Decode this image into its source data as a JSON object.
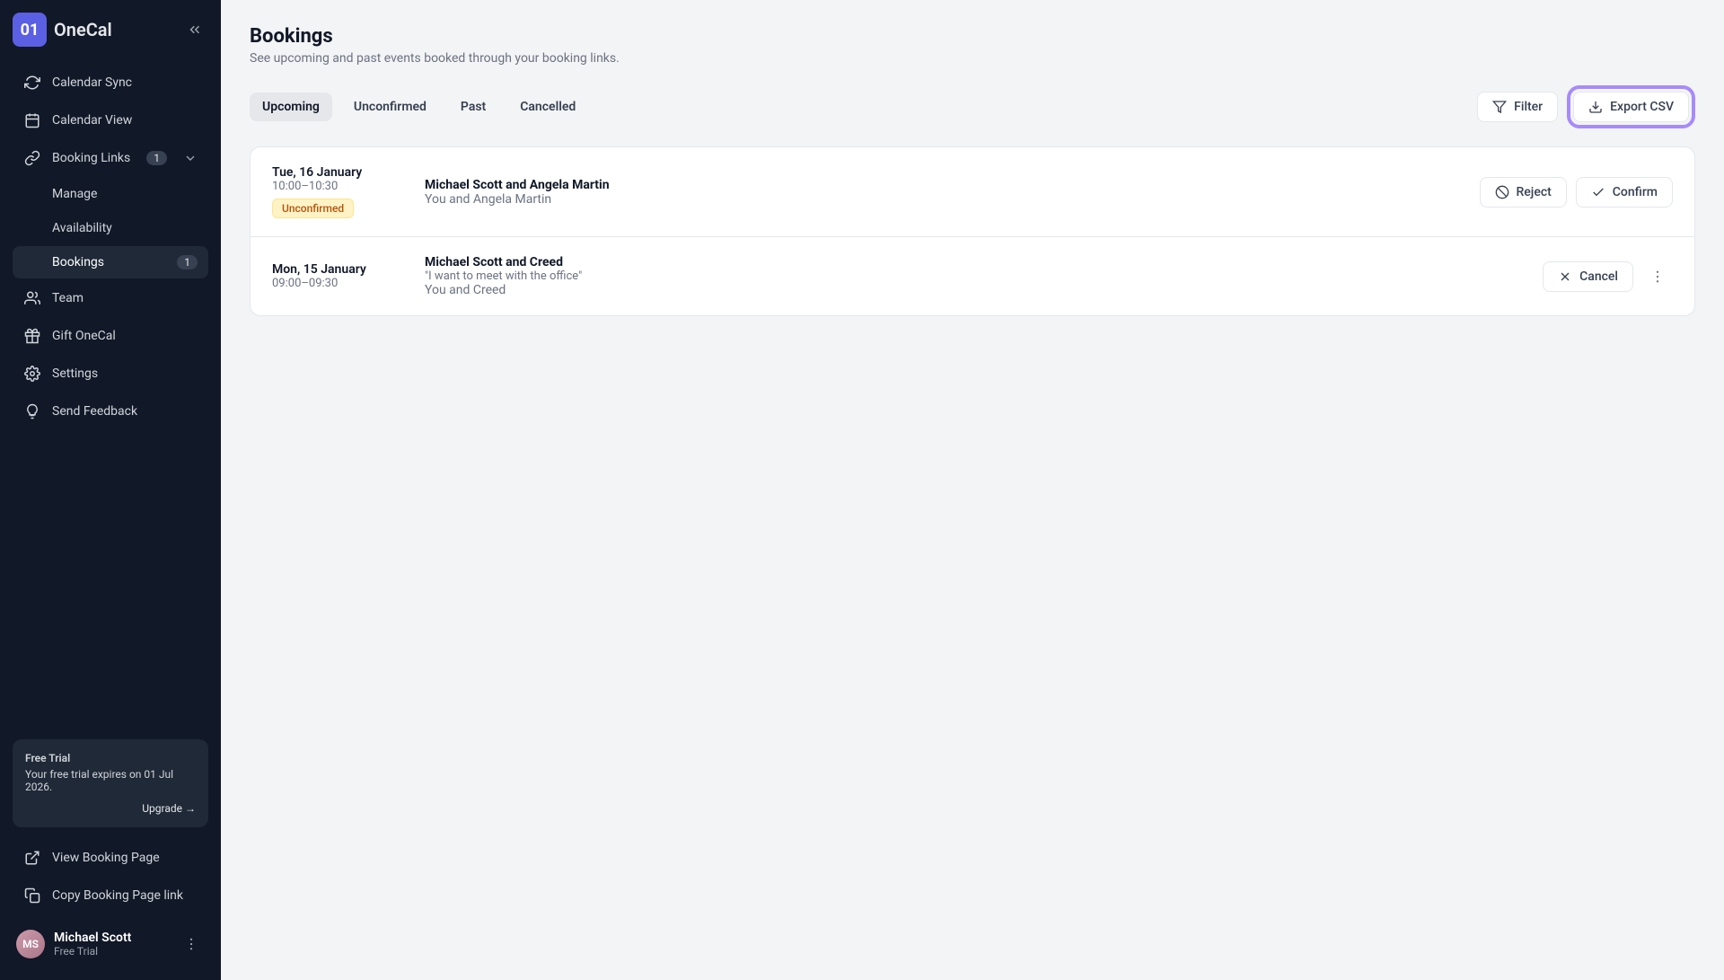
{
  "brand": {
    "logo_text": "01",
    "name": "OneCal"
  },
  "sidebar": {
    "items": [
      {
        "label": "Calendar Sync"
      },
      {
        "label": "Calendar View"
      },
      {
        "label": "Booking Links",
        "badge": "1"
      },
      {
        "label": "Manage"
      },
      {
        "label": "Availability"
      },
      {
        "label": "Bookings",
        "badge": "1"
      },
      {
        "label": "Team"
      },
      {
        "label": "Gift OneCal"
      },
      {
        "label": "Settings"
      },
      {
        "label": "Send Feedback"
      }
    ],
    "bottom": [
      {
        "label": "View Booking Page"
      },
      {
        "label": "Copy Booking Page link"
      }
    ]
  },
  "trial": {
    "title": "Free Trial",
    "text": "Your free trial expires on 01 Jul 2026.",
    "upgrade": "Upgrade →"
  },
  "user": {
    "name": "Michael Scott",
    "plan": "Free Trial",
    "initials": "MS"
  },
  "page": {
    "title": "Bookings",
    "subtitle": "See upcoming and past events booked through your booking links."
  },
  "tabs": [
    {
      "label": "Upcoming",
      "active": true
    },
    {
      "label": "Unconfirmed"
    },
    {
      "label": "Past"
    },
    {
      "label": "Cancelled"
    }
  ],
  "toolbar": {
    "filter": "Filter",
    "export": "Export CSV"
  },
  "bookings": [
    {
      "date": "Tue, 16 January",
      "time": "10:00–10:30",
      "status": "Unconfirmed",
      "title": "Michael Scott and Angela Martin",
      "quote": "",
      "people": "You and Angela Martin",
      "actions": {
        "reject": "Reject",
        "confirm": "Confirm"
      }
    },
    {
      "date": "Mon, 15 January",
      "time": "09:00–09:30",
      "status": "",
      "title": "Michael Scott and Creed",
      "quote": "\"I want to meet with the office\"",
      "people": "You and Creed",
      "actions": {
        "cancel": "Cancel"
      }
    }
  ]
}
